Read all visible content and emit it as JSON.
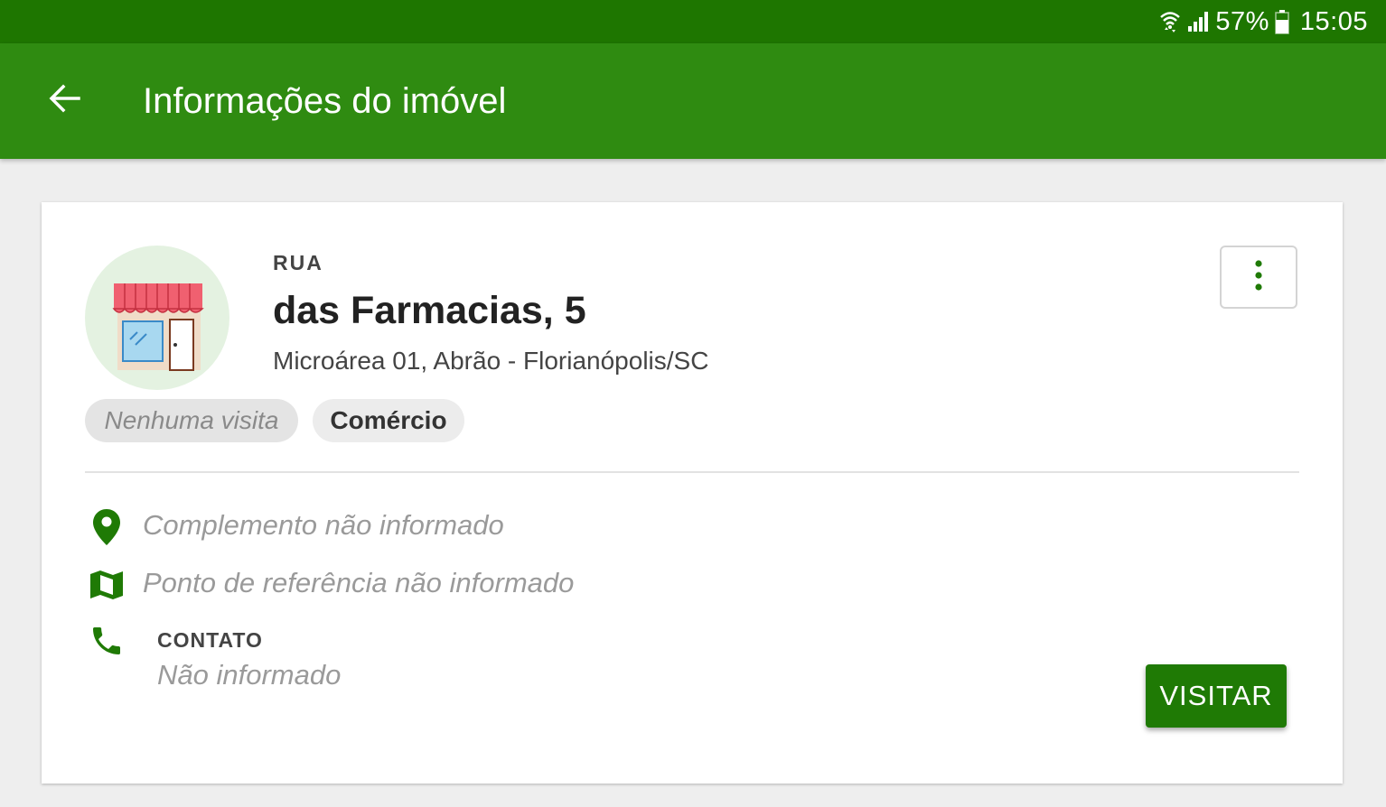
{
  "status_bar": {
    "battery": "57%",
    "time": "15:05"
  },
  "app_bar": {
    "title": "Informações do imóvel"
  },
  "property": {
    "street_type": "RUA",
    "street_name": "das Farmacias, 5",
    "location": "Microárea 01, Abrão - Florianópolis/SC",
    "chips": {
      "visit_status": "Nenhuma visita",
      "category": "Comércio"
    }
  },
  "details": {
    "complement": "Complemento não informado",
    "reference": "Ponto de referência não informado",
    "contact_label": "CONTATO",
    "contact_value": "Não informado"
  },
  "actions": {
    "visit_button": "VISITAR"
  },
  "colors": {
    "status_bar": "#1e7600",
    "app_bar": "#2f8b11",
    "accent": "#1f7a05",
    "avatar_bg": "#e4f2e1"
  },
  "icons": [
    "wifi-icon",
    "signal-icon",
    "battery-icon",
    "back-arrow-icon",
    "store-icon",
    "more-vert-icon",
    "location-pin-icon",
    "map-icon",
    "phone-icon"
  ]
}
